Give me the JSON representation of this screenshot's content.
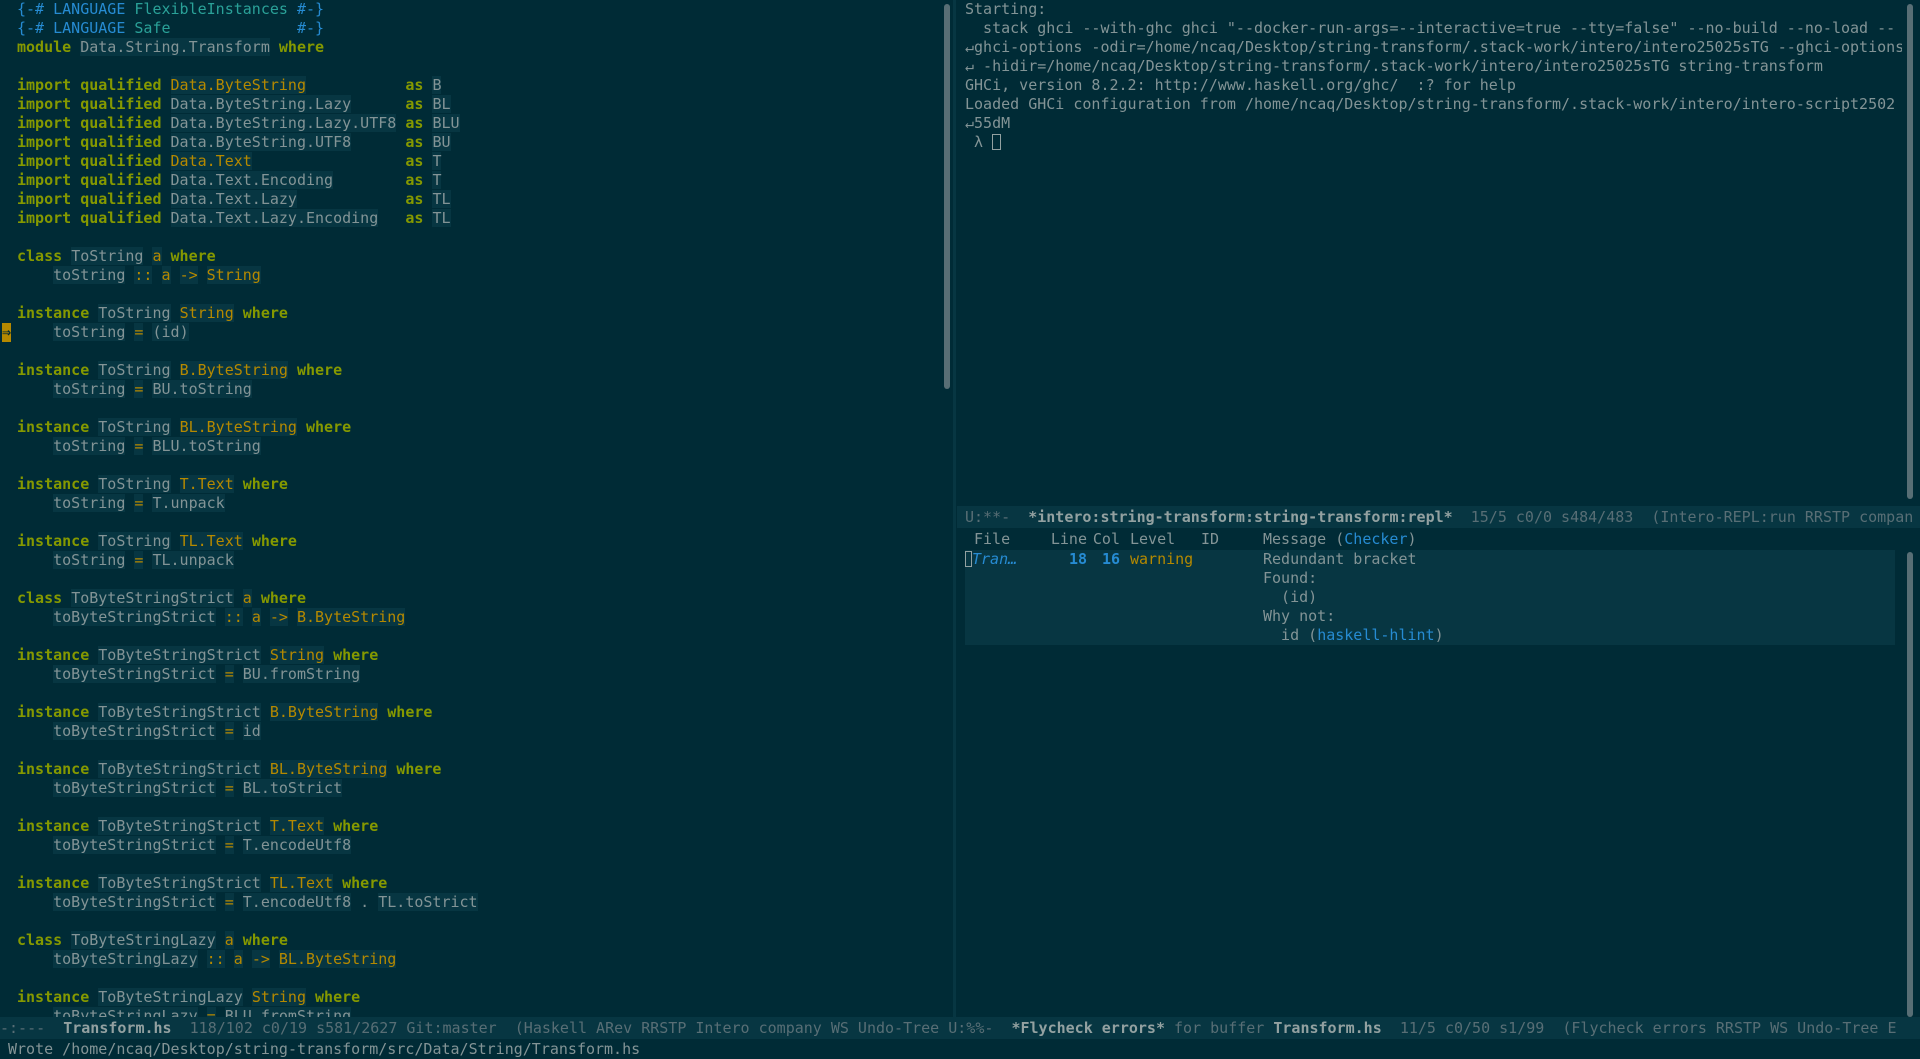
{
  "left_editor": {
    "lines": [
      "{-# LANGUAGE FlexibleInstances #-}",
      "{-# LANGUAGE Safe              #-}",
      "module Data.String.Transform where",
      "",
      "import qualified Data.ByteString           as B",
      "import qualified Data.ByteString.Lazy      as BL",
      "import qualified Data.ByteString.Lazy.UTF8 as BLU",
      "import qualified Data.ByteString.UTF8      as BU",
      "import qualified Data.Text                 as T",
      "import qualified Data.Text.Encoding        as T",
      "import qualified Data.Text.Lazy            as TL",
      "import qualified Data.Text.Lazy.Encoding   as TL",
      "",
      "class ToString a where",
      "    toString :: a -> String",
      "",
      "instance ToString String where",
      "    toString = (id)",
      "",
      "instance ToString B.ByteString where",
      "    toString = BU.toString",
      "",
      "instance ToString BL.ByteString where",
      "    toString = BLU.toString",
      "",
      "instance ToString T.Text where",
      "    toString = T.unpack",
      "",
      "instance ToString TL.Text where",
      "    toString = TL.unpack",
      "",
      "class ToByteStringStrict a where",
      "    toByteStringStrict :: a -> B.ByteString",
      "",
      "instance ToByteStringStrict String where",
      "    toByteStringStrict = BU.fromString",
      "",
      "instance ToByteStringStrict B.ByteString where",
      "    toByteStringStrict = id",
      "",
      "instance ToByteStringStrict BL.ByteString where",
      "    toByteStringStrict = BL.toStrict",
      "",
      "instance ToByteStringStrict T.Text where",
      "    toByteStringStrict = T.encodeUtf8",
      "",
      "instance ToByteStringStrict TL.Text where",
      "    toByteStringStrict = T.encodeUtf8 . TL.toStrict",
      "",
      "class ToByteStringLazy a where",
      "    toByteStringLazy :: a -> BL.ByteString",
      "",
      "instance ToByteStringLazy String where",
      "    toByteStringLazy = BLU.fromString"
    ],
    "fringe_marker": "⇒"
  },
  "repl": {
    "lines": [
      "Starting:",
      "  stack ghci --with-ghc ghci \"--docker-run-args=--interactive=true --tty=false\" --no-build --no-load -- ↵",
      "↵ghci-options -odir=/home/ncaq/Desktop/string-transform/.stack-work/intero/intero25025sTG --ghci-options ↵",
      "↵ -hidir=/home/ncaq/Desktop/string-transform/.stack-work/intero/intero25025sTG string-transform",
      "GHCi, version 8.2.2: http://www.haskell.org/ghc/  :? for help",
      "Loaded GHCi configuration from /home/ncaq/Desktop/string-transform/.stack-work/intero/intero-script2502 ↵",
      "↵55dM"
    ],
    "prompt": "λ",
    "modeline": {
      "status": "U:**-",
      "buffer": "*intero:string-transform:string-transform:repl*",
      "position": "15/5 c0/0 s484/483",
      "modes": "(Intero-REPL:run RRSTP compan"
    }
  },
  "flycheck": {
    "headers": {
      "file": "File",
      "line": "Line",
      "col": "Col",
      "level": "Level",
      "id": "ID",
      "message": "Message",
      "checker": "Checker"
    },
    "rows": [
      {
        "file": "Tran…",
        "line": "18",
        "col": "16",
        "level": "warning",
        "message": [
          "Redundant bracket",
          "Found:",
          "  (id)",
          "Why not:",
          "  id"
        ],
        "checker": "haskell-hlint"
      }
    ]
  },
  "main_modeline": {
    "left": {
      "status": "-:---",
      "buffer": "Transform.hs",
      "position": "118/102 c0/19 s581/2627 Git:master",
      "modes": "(Haskell ARev RRSTP Intero company WS Undo-Tree"
    },
    "right": {
      "status": "U:%%-",
      "buffer": "*Flycheck errors*",
      "for_label": "for buffer",
      "target": "Transform.hs",
      "position": "11/5 c0/50 s1/99",
      "modes": "(Flycheck errors RRSTP WS Undo-Tree E"
    }
  },
  "echo_area": "Wrote /home/ncaq/Desktop/string-transform/src/Data/String/Transform.hs",
  "colors": {
    "background": "#002b36",
    "highlight": "#073642",
    "keyword": "#859900",
    "type": "#b58900",
    "pragma": "#268bd2",
    "text": "#839496"
  }
}
